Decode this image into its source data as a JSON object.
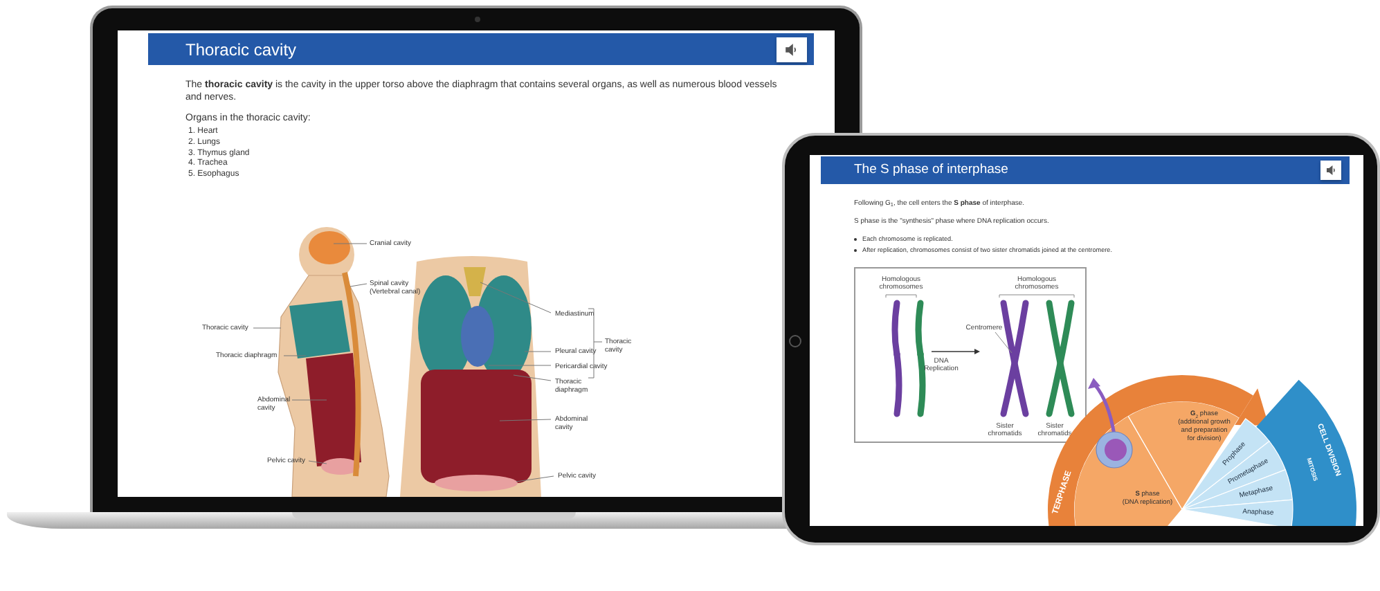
{
  "laptop": {
    "title": "Thoracic cavity",
    "intro": "The **thoracic cavity** is the cavity in the upper torso above the diaphragm that contains several organs, as well as numerous blood vessels and nerves.",
    "list_heading": "Organs in the thoracic cavity:",
    "organs": [
      {
        "number": "1.",
        "name": "Heart"
      },
      {
        "number": "2.",
        "name": "Lungs"
      },
      {
        "number": "3.",
        "name": "Thymus gland"
      },
      {
        "number": "4.",
        "name": "Trachea"
      },
      {
        "number": "5.",
        "name": "Esophagus"
      }
    ],
    "figure_labels": [
      [
        "Cranial cavity"
      ],
      [
        "Spinal cavity",
        "(Vertebral canal)"
      ],
      [
        "Thoracic cavity"
      ],
      [
        "Thoracic diaphragm"
      ],
      [
        "Abdominal",
        "cavity"
      ],
      [
        "Pelvic cavity"
      ],
      [
        "Mediastinum"
      ],
      [
        "Pleural cavity"
      ],
      [
        "Pericardial cavity"
      ],
      [
        "Thoracic",
        "diaphragm"
      ],
      [
        "Abdominal",
        "cavity"
      ],
      [
        "Pelvic cavity"
      ],
      [
        "Thoracic",
        "cavity"
      ]
    ]
  },
  "tablet": {
    "title": "The S phase of interphase",
    "paragraphs": [
      "Following G$_{1}$, the cell enters the **S phase** of interphase.",
      "S phase is the \"synthesis\" phase where DNA replication occurs."
    ],
    "bullets": [
      "Each chromosome is replicated.",
      "After replication, chromosomes consist of two sister chromatids joined at the centromere."
    ],
    "chromosome_labels": [
      [
        "Homologous",
        "chromosomes"
      ],
      [
        "Homologous",
        "chromosomes"
      ],
      [
        "Centromere"
      ],
      [
        "DNA",
        "Replication"
      ],
      [
        "Sister",
        "chromatids"
      ],
      [
        "Sister",
        "chromatids"
      ]
    ],
    "cell_cycle": {
      "g2_phase": [
        "**G**$_{2}$ phase",
        "(additional growth",
        "and preparation",
        "for division)"
      ],
      "s_phase": [
        "**S** phase",
        "(DNA replication)"
      ],
      "interphase": "TERPHASE",
      "cell_division": "CELL DIVISION",
      "mitosis": "MITOSIS",
      "stages": [
        "Prophase",
        "Prometaphase",
        "Metaphase",
        "Anaphase"
      ]
    }
  }
}
